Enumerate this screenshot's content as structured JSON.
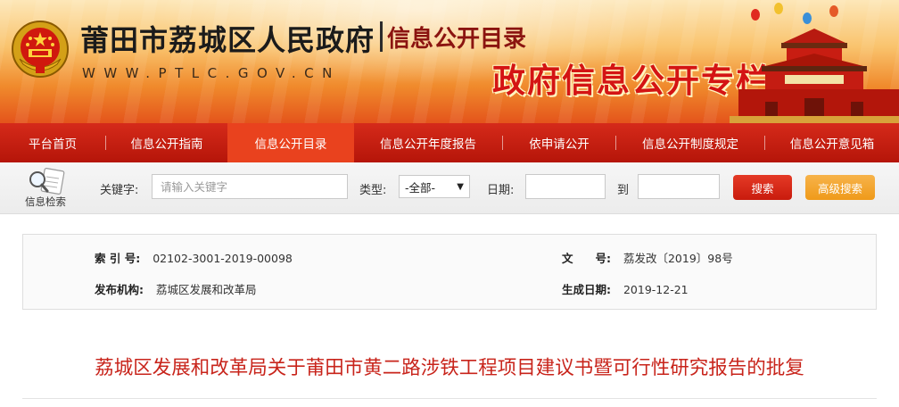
{
  "header": {
    "site_name": "莆田市荔城区人民政府",
    "section_name": "信息公开目录",
    "site_url": "WWW.PTLC.GOV.CN",
    "column_name": "政府信息公开专栏"
  },
  "nav": {
    "items": [
      {
        "label": "平台首页",
        "active": false
      },
      {
        "label": "信息公开指南",
        "active": false
      },
      {
        "label": "信息公开目录",
        "active": true
      },
      {
        "label": "信息公开年度报告",
        "active": false
      },
      {
        "label": "依申请公开",
        "active": false
      },
      {
        "label": "信息公开制度规定",
        "active": false
      },
      {
        "label": "信息公开意见箱",
        "active": false
      }
    ]
  },
  "search": {
    "logo_label": "信息检索",
    "keyword_label": "关键字:",
    "keyword_placeholder": "请输入关键字",
    "type_label": "类型:",
    "type_value": "-全部-",
    "date_label": "日期:",
    "to_label": "到",
    "search_button": "搜索",
    "advanced_button": "高级搜索"
  },
  "meta": {
    "index_label": "索 引 号:",
    "index_value": "02102-3001-2019-00098",
    "docno_label": "文　　号:",
    "docno_value": "荔发改〔2019〕98号",
    "publisher_label": "发布机构:",
    "publisher_value": "荔城区发展和改革局",
    "date_label": "生成日期:",
    "date_value": "2019-12-21"
  },
  "document": {
    "title": "荔城区发展和改革局关于莆田市黄二路涉铁工程项目建议书暨可行性研究报告的批复"
  },
  "colors": {
    "nav_red": "#c41f10",
    "nav_active": "#e9421e",
    "title_red": "#c8241b",
    "column_red": "#d41414",
    "search_button": "#d42a19",
    "advanced_button": "#f2a42b"
  }
}
